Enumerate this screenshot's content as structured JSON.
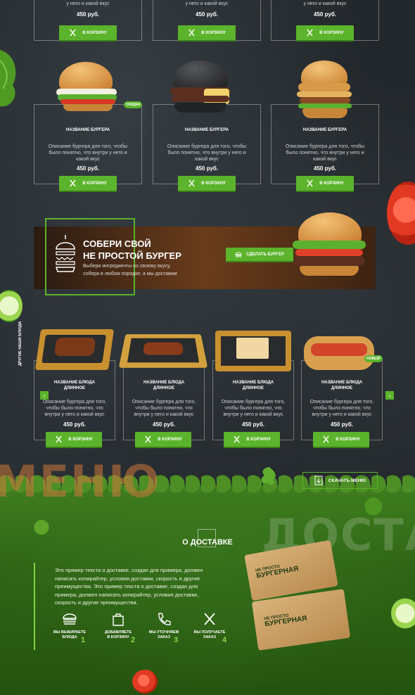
{
  "cart_label": "В КОРЗИНУ",
  "top_row": {
    "prices": [
      "450 руб.",
      "450 руб.",
      "450 руб."
    ],
    "desc_tail": "у него и какой вкус"
  },
  "burgers": [
    {
      "name": "НАЗВАНИЕ БУРГЕРА",
      "desc": "Описание бургера для того, чтобы было понятно, что внутри у него и какой вкус",
      "price": "450 руб.",
      "badge": "СКИДКА"
    },
    {
      "name": "НАЗВАНИЕ БУРГЕРА",
      "desc": "Описание бургера для того, чтобы было понятно, что внутри у него и какой вкус",
      "price": "450 руб.",
      "badge": ""
    },
    {
      "name": "НАЗВАНИЕ БУРГЕРА",
      "desc": "Описание бургера для того, чтобы было понятно, что внутри у него и какой вкус",
      "price": "450 руб.",
      "badge": ""
    }
  ],
  "promo": {
    "title_line1": "СОБЕРИ СВОЙ",
    "title_line2": "НЕ ПРОСТОЙ БУРГЕР",
    "sub_line1": "Выбери ингредиенты по своему вкусу,",
    "sub_line2": "собери в любом порядке, а мы доставим",
    "button": "СДЕЛАТЬ БУРГЕР"
  },
  "other_dishes": {
    "side_label": "ДРУГИЕ НАШИ БЛЮДА",
    "items": [
      {
        "name_line1": "НАЗВАНИЕ БЛЮДА",
        "name_line2": "ДЛИННОЕ",
        "desc": "Описание бургера для того, чтобы было понятно, что внутри у него и какой вкус",
        "price": "450 руб.",
        "badge": ""
      },
      {
        "name_line1": "НАЗВАНИЕ БЛЮДА",
        "name_line2": "ДЛИННОЕ",
        "desc": "Описание бургера для того, чтобы было понятно, что внутри у него и какой вкус",
        "price": "450 руб.",
        "badge": ""
      },
      {
        "name_line1": "НАЗВАНИЕ БЛЮДА",
        "name_line2": "ДЛИННОЕ",
        "desc": "Описание бургера для того, чтобы было понятно, что внутри у него и какой вкус",
        "price": "450 руб.",
        "badge": ""
      },
      {
        "name_line1": "НАЗВАНИЕ БЛЮДА",
        "name_line2": "ДЛИННОЕ",
        "desc": "Описание бургера для того, чтобы было понятно, что внутри у него и какой вкус",
        "price": "450 руб.",
        "badge": "НОВЫЙ"
      }
    ]
  },
  "menu_word": "МЕНЮ",
  "download_menu": "СКАЧАТЬ МЕНЮ",
  "delivery": {
    "title": "О ДОСТАВКЕ",
    "bg_word": "ДОСТА",
    "text": "Это пример текста о доставке, создан для примера, должен написать копирайтер, условия доставки, скорость и другие преимущества. Это пример текста о доставке, создан для примера, должен написать копирайтер, условия доставки, скорость и другие преимущества.",
    "steps": [
      {
        "label_line1": "ВЫ ВЫБИРАЕТЕ",
        "label_line2": "БЛЮДА",
        "num": "1"
      },
      {
        "label_line1": "ДОБАВЛЯЕТЕ",
        "label_line2": "В КОРЗИНУ",
        "num": "2"
      },
      {
        "label_line1": "МЫ УТОЧНЯЕМ",
        "label_line2": "ЗАКАЗ",
        "num": "3"
      },
      {
        "label_line1": "ВЫ ПОЛУЧАЕТЕ",
        "label_line2": "ЗАКАЗ",
        "num": "4"
      }
    ],
    "box_small": "НЕ ПРОСТО",
    "box_big": "БУРГЕРНАЯ"
  },
  "colors": {
    "accent": "#5bb42b",
    "background": "#22272b",
    "grass": "#3f7d1e"
  }
}
